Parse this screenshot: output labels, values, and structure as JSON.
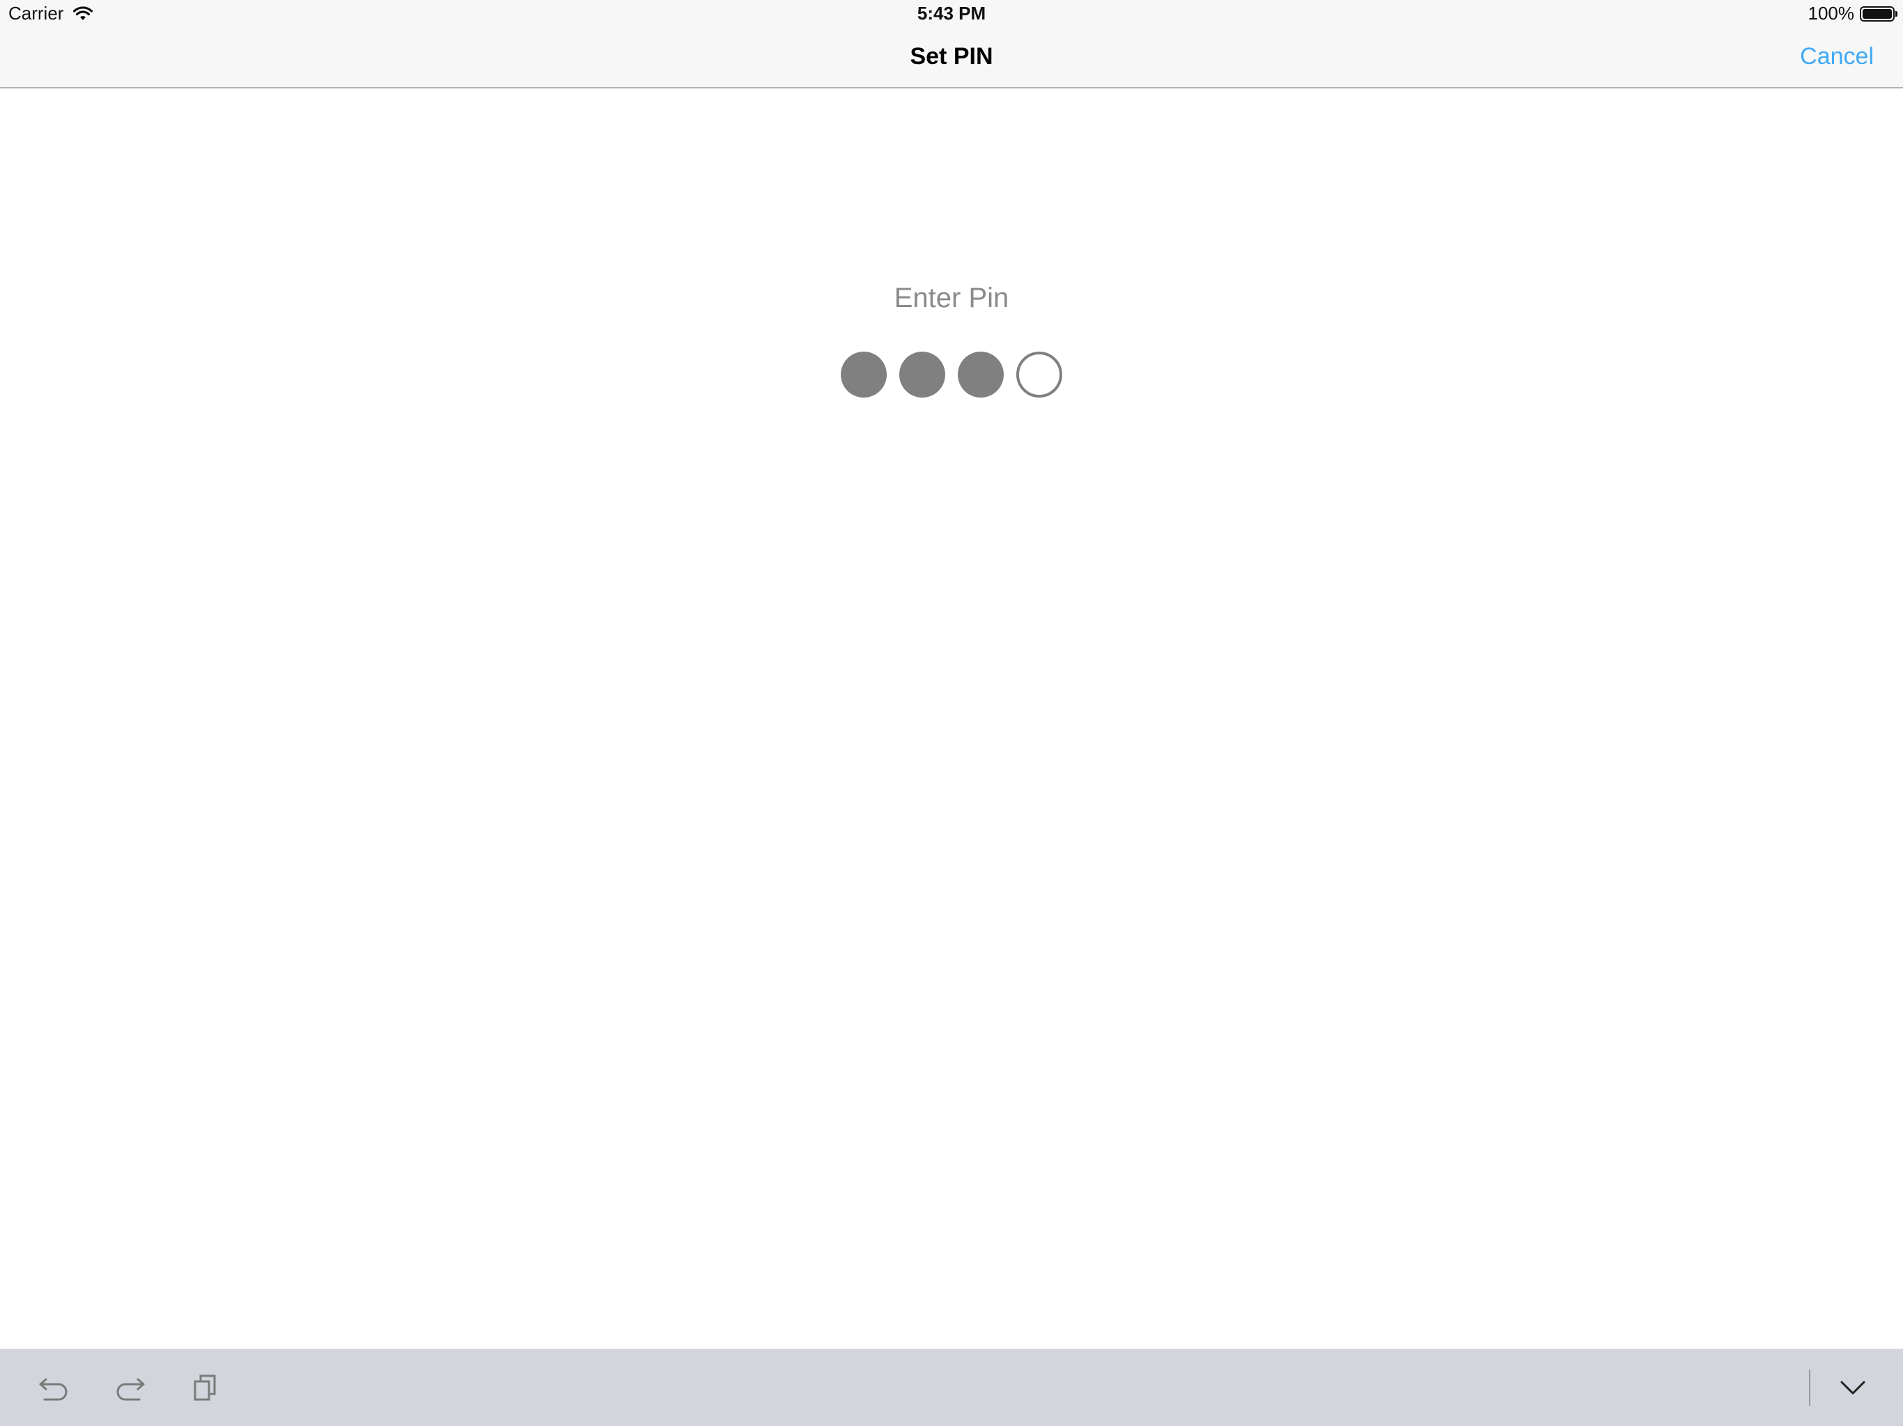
{
  "status_bar": {
    "carrier": "Carrier",
    "time": "5:43 PM",
    "battery_percent": "100%",
    "battery_level": 1.0
  },
  "nav": {
    "title": "Set PIN",
    "cancel_label": "Cancel",
    "accent_color": "#3fa9f5"
  },
  "pin": {
    "prompt": "Enter Pin",
    "length": 4,
    "entered": 3,
    "dot_color": "#808080"
  },
  "assistant_bar": {
    "background": "#d2d5db",
    "icons": [
      "undo-icon",
      "redo-icon",
      "paste-icon",
      "keyboard-dismiss-icon"
    ]
  }
}
